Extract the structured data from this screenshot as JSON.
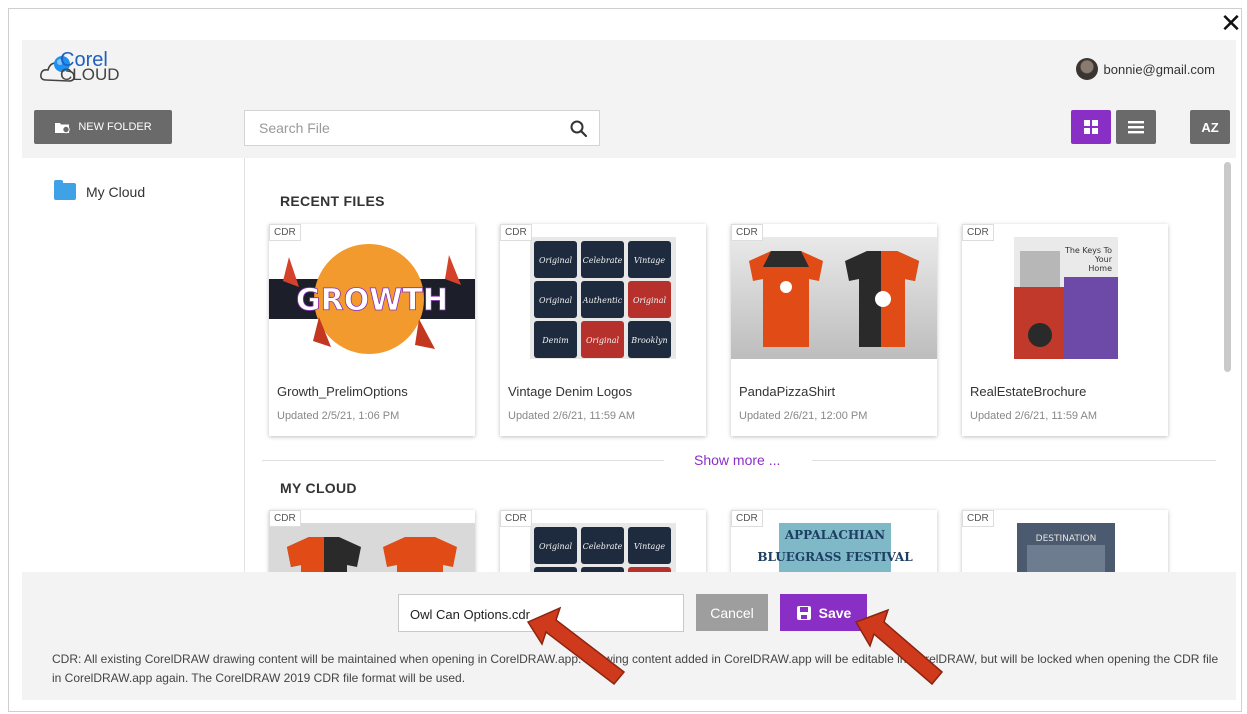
{
  "window": {
    "close_glyph": "✕"
  },
  "header": {
    "brand_line1": "Corel",
    "brand_line2": "CLOUD",
    "account_email": "bonnie@gmail.com"
  },
  "toolbar": {
    "new_folder_label": "NEW FOLDER",
    "search_placeholder": "Search File",
    "sort_label": "AZ"
  },
  "sidebar": {
    "items": [
      {
        "label": "My Cloud",
        "icon": "folder-icon"
      }
    ]
  },
  "recent": {
    "title": "RECENT FILES",
    "cards": [
      {
        "badge": "CDR",
        "name": "Growth_PrelimOptions",
        "date": "Updated 2/5/21, 1:06 PM",
        "thumb": "growth"
      },
      {
        "badge": "CDR",
        "name": "Vintage Denim Logos",
        "date": "Updated 2/6/21, 11:59 AM",
        "thumb": "vintage"
      },
      {
        "badge": "CDR",
        "name": "PandaPizzaShirt",
        "date": "Updated 2/6/21, 12:00 PM",
        "thumb": "shirt"
      },
      {
        "badge": "CDR",
        "name": "RealEstateBrochure",
        "date": "Updated 2/6/21, 11:59 AM",
        "thumb": "brochure"
      }
    ],
    "show_more": "Show more ..."
  },
  "mycloud": {
    "title": "MY CLOUD",
    "cards": [
      {
        "badge": "CDR",
        "thumb": "shirt"
      },
      {
        "badge": "CDR",
        "thumb": "vintage"
      },
      {
        "badge": "CDR",
        "thumb": "bluegrass"
      },
      {
        "badge": "CDR",
        "thumb": "destination"
      }
    ]
  },
  "thumb_text": {
    "growth": "GROWTH",
    "vintage": [
      "Original",
      "Celebrate",
      "Vintage",
      "Original",
      "Authentic",
      "Original",
      "Denim",
      "Original",
      "Brooklyn"
    ],
    "brochure_heading": [
      "The Keys To",
      "Your",
      "Home"
    ],
    "bluegrass": [
      "APPALACHIAN",
      "BLUEGRASS FESTIVAL"
    ],
    "destination": "DESTINATION"
  },
  "footer": {
    "filename_value": "Owl Can Options.cdr",
    "cancel_label": "Cancel",
    "save_label": "Save",
    "note": "CDR: All existing CorelDRAW drawing content will be maintained when opening in CorelDRAW.app. Drawing content added in CorelDRAW.app will be editable in CorelDRAW, but will be locked when opening the CDR file in CorelDRAW.app again. The CorelDRAW 2019 CDR file format will be used."
  },
  "colors": {
    "accent": "#8a2fc6",
    "gray_button": "#6a6a6a",
    "arrow": "#cf3a1c"
  }
}
